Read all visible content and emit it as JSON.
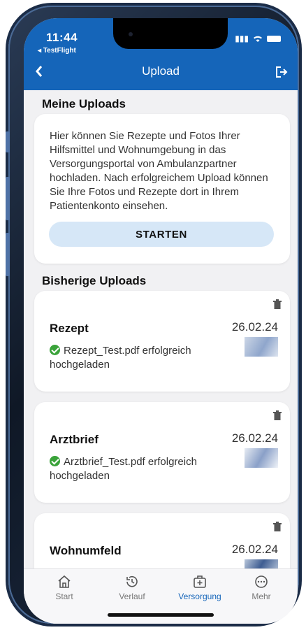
{
  "status_bar": {
    "time": "11:44",
    "back_app": "TestFlight"
  },
  "header": {
    "back_icon": "chevron-left-icon",
    "title": "Upload",
    "logout_icon": "logout-icon"
  },
  "my_uploads": {
    "heading": "Meine Uploads",
    "intro_text": "Hier können Sie Rezepte und Fotos Ihrer Hilfsmittel und Wohnumgebung in das Versorgungsportal von Ambulanzpartner hochladen. Nach erfolgreichem Upload können Sie Ihre Fotos und Rezepte dort in Ihrem Patientenkonto einsehen.",
    "start_button": "STARTEN"
  },
  "previous_uploads": {
    "heading": "Bisherige Uploads",
    "items": [
      {
        "title": "Rezept",
        "date": "26.02.24",
        "status": "Rezept_Test.pdf erfolgreich hochgeladen"
      },
      {
        "title": "Arztbrief",
        "date": "26.02.24",
        "status": "Arztbrief_Test.pdf erfolgreich hochgeladen"
      },
      {
        "title": "Wohnumfeld",
        "date": "26.02.24",
        "status": ""
      }
    ]
  },
  "tabbar": {
    "tabs": [
      {
        "label": "Start",
        "icon": "home-icon",
        "active": false
      },
      {
        "label": "Verlauf",
        "icon": "history-icon",
        "active": false
      },
      {
        "label": "Versorgung",
        "icon": "medical-bag-icon",
        "active": true
      },
      {
        "label": "Mehr",
        "icon": "more-icon",
        "active": false
      }
    ]
  },
  "colors": {
    "primary": "#1565b9",
    "success": "#3aa33a",
    "button_bg": "#d6e7f7"
  }
}
